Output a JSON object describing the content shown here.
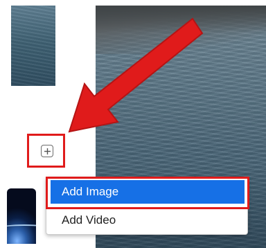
{
  "menu": {
    "items": [
      {
        "label": "Add Image",
        "selected": true
      },
      {
        "label": "Add Video",
        "selected": false
      }
    ]
  },
  "colors": {
    "highlight": "#e01b1b",
    "selected_item": "#1670e6",
    "arrow": "#e01b1b"
  },
  "icons": {
    "add": "plus-icon"
  }
}
